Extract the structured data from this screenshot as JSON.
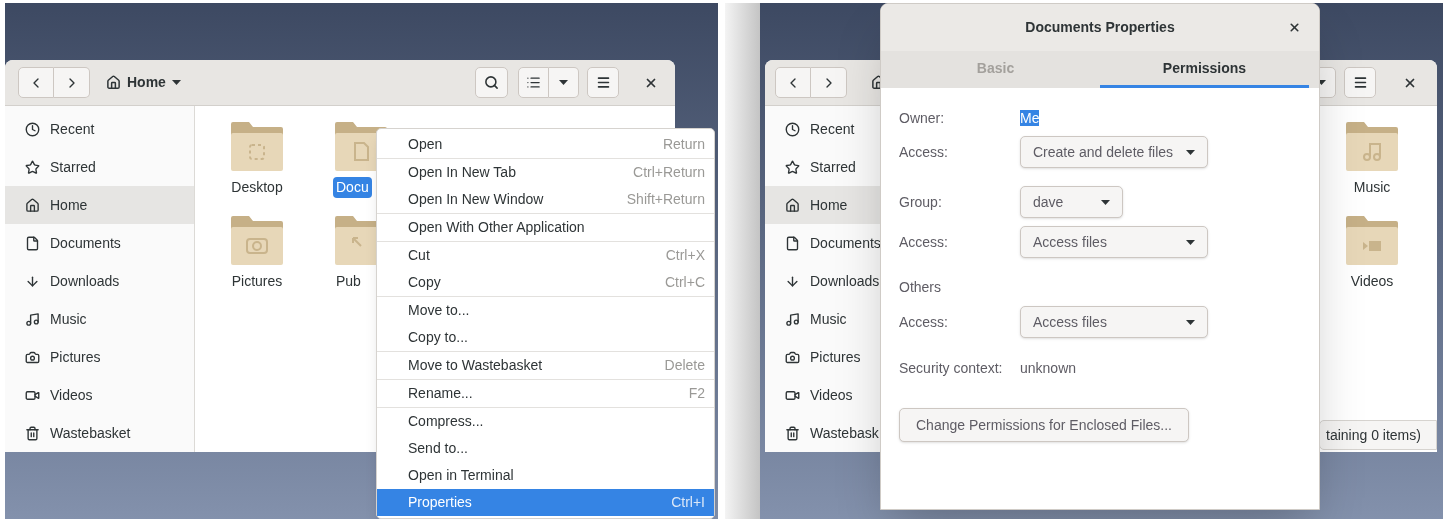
{
  "left": {
    "file_manager": {
      "location": "Home",
      "sidebar": [
        {
          "label": "Recent",
          "selected": false
        },
        {
          "label": "Starred",
          "selected": false
        },
        {
          "label": "Home",
          "selected": true
        },
        {
          "label": "Documents",
          "selected": false
        },
        {
          "label": "Downloads",
          "selected": false
        },
        {
          "label": "Music",
          "selected": false
        },
        {
          "label": "Pictures",
          "selected": false
        },
        {
          "label": "Videos",
          "selected": false
        },
        {
          "label": "Wastebasket",
          "selected": false
        }
      ],
      "folders": [
        {
          "label": "Desktop",
          "selected": false
        },
        {
          "label": "Docu",
          "selected": true
        },
        {
          "label": "Pictures",
          "selected": false
        },
        {
          "label": "Pub",
          "selected": false
        }
      ]
    },
    "context_menu": {
      "sections": [
        {
          "items": [
            {
              "label": "Open",
              "shortcut": "Return",
              "selected": false
            }
          ]
        },
        {
          "items": [
            {
              "label": "Open In New Tab",
              "shortcut": "Ctrl+Return",
              "selected": false
            },
            {
              "label": "Open In New Window",
              "shortcut": "Shift+Return",
              "selected": false
            }
          ]
        },
        {
          "items": [
            {
              "label": "Open With Other Application",
              "selected": false
            }
          ]
        },
        {
          "items": [
            {
              "label": "Cut",
              "shortcut": "Ctrl+X",
              "selected": false
            },
            {
              "label": "Copy",
              "shortcut": "Ctrl+C",
              "selected": false
            }
          ]
        },
        {
          "items": [
            {
              "label": "Move to...",
              "selected": false
            },
            {
              "label": "Copy to...",
              "selected": false
            }
          ]
        },
        {
          "items": [
            {
              "label": "Move to Wastebasket",
              "shortcut": "Delete",
              "selected": false
            }
          ]
        },
        {
          "items": [
            {
              "label": "Rename...",
              "shortcut": "F2",
              "selected": false
            }
          ]
        },
        {
          "items": [
            {
              "label": "Compress...",
              "selected": false
            },
            {
              "label": "Send to...",
              "selected": false
            },
            {
              "label": "Open in Terminal",
              "selected": false
            },
            {
              "label": "Properties",
              "shortcut": "Ctrl+I",
              "selected": true
            }
          ]
        }
      ]
    }
  },
  "right": {
    "file_manager": {
      "sidebar": [
        {
          "label": "Recent",
          "selected": false
        },
        {
          "label": "Starred",
          "selected": false
        },
        {
          "label": "Home",
          "selected": true
        },
        {
          "label": "Documents",
          "selected": false
        },
        {
          "label": "Downloads",
          "selected": false
        },
        {
          "label": "Music",
          "selected": false
        },
        {
          "label": "Pictures",
          "selected": false
        },
        {
          "label": "Videos",
          "selected": false
        },
        {
          "label": "Wastebask",
          "selected": false
        }
      ],
      "folders": [
        {
          "label": "Music"
        },
        {
          "label": "Videos"
        }
      ],
      "status_bar": "taining 0 items)"
    },
    "dialog": {
      "title": "Documents Properties",
      "tabs": [
        {
          "label": "Basic",
          "selected": false
        },
        {
          "label": "Permissions",
          "selected": true
        }
      ],
      "groups": [
        {
          "rows": [
            {
              "kind": "value",
              "label": "Owner:",
              "value": "Me",
              "highlighted": true
            },
            {
              "kind": "select",
              "label": "Access:",
              "value": "Create and delete files"
            }
          ]
        },
        {
          "rows": [
            {
              "kind": "picker",
              "label": "Group:",
              "value": "dave"
            },
            {
              "kind": "select",
              "label": "Access:",
              "value": "Access files"
            }
          ]
        },
        {
          "rows": [
            {
              "kind": "heading",
              "label": "Others"
            },
            {
              "kind": "select",
              "label": "Access:",
              "value": "Access files"
            }
          ]
        },
        {
          "rows": [
            {
              "kind": "value",
              "label": "Security context:",
              "value": "unknown",
              "highlighted": false
            }
          ]
        }
      ],
      "button": "Change Permissions for Enclosed Files..."
    }
  }
}
